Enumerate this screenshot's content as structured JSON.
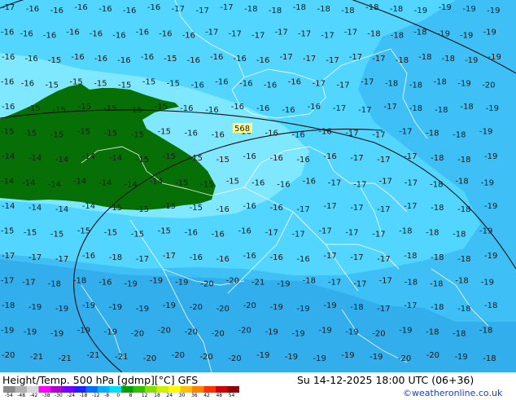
{
  "map": {
    "colors": {
      "band_minus_14_15": "#7fe8ff",
      "band_minus_16_17": "#52d6ff",
      "band_minus_18_19": "#3ec0f6",
      "band_minus_20": "#32aeec",
      "warm_core": "#067006",
      "border_lines": "#ffffff",
      "contour_lines": "#111111",
      "label_text": "#1a1a1a",
      "height_label_bg": "#ffff90"
    },
    "height_contour_label": "568",
    "temperature_rows": [
      [
        "-17",
        "-16",
        "-16",
        "-16",
        "-16",
        "-16",
        "-16",
        "-17",
        "-17",
        "-17",
        "-18",
        "-18",
        "-18",
        "-18",
        "-18",
        "-18",
        "-18",
        "-19",
        "-19",
        "-19",
        "-19"
      ],
      [
        "-16",
        "-16",
        "-16",
        "-16",
        "-16",
        "-16",
        "-16",
        "-16",
        "-16",
        "-17",
        "-17",
        "-17",
        "-17",
        "-17",
        "-17",
        "-17",
        "-18",
        "-18",
        "-18",
        "-19",
        "-19",
        "-19"
      ],
      [
        "-16",
        "-16",
        "-15",
        "-16",
        "-16",
        "-16",
        "-16",
        "-15",
        "-16",
        "-16",
        "-16",
        "-16",
        "-17",
        "-17",
        "-17",
        "-17",
        "-17",
        "-18",
        "-18",
        "-18",
        "-19",
        "-19"
      ],
      [
        "-16",
        "-16",
        "-15",
        "-15",
        "-15",
        "-15",
        "-15",
        "-15",
        "-16",
        "-16",
        "-16",
        "-16",
        "-16",
        "-17",
        "-17",
        "-17",
        "-18",
        "-18",
        "-18",
        "-19",
        "-20"
      ],
      [
        "-16",
        "-15",
        "-15",
        "-15",
        "-15",
        "-15",
        "-15",
        "-16",
        "-16",
        "-16",
        "-16",
        "-16",
        "-16",
        "-17",
        "-17",
        "-17",
        "-18",
        "-18",
        "-18",
        "-19"
      ],
      [
        "-15",
        "-15",
        "-15",
        "-15",
        "-15",
        "-15",
        "-15",
        "-16",
        "-16",
        "-16",
        "-16",
        "-16",
        "-16",
        "-17",
        "-17",
        "-17",
        "-18",
        "-18",
        "-19"
      ],
      [
        "-14",
        "-14",
        "-14",
        "-14",
        "-14",
        "-15",
        "-15",
        "-15",
        "-15",
        "-16",
        "-16",
        "-16",
        "-16",
        "-17",
        "-17",
        "-17",
        "-18",
        "-18",
        "-19"
      ],
      [
        "-14",
        "-14",
        "-14",
        "-14",
        "-14",
        "-14",
        "-14",
        "-15",
        "-15",
        "-15",
        "-16",
        "-16",
        "-16",
        "-17",
        "-17",
        "-17",
        "-17",
        "-18",
        "-18",
        "-19"
      ],
      [
        "-14",
        "-14",
        "-14",
        "-14",
        "-15",
        "-15",
        "-15",
        "-15",
        "-16",
        "-16",
        "-16",
        "-17",
        "-17",
        "-17",
        "-17",
        "-17",
        "-18",
        "-18",
        "-19"
      ],
      [
        "-15",
        "-15",
        "-15",
        "-15",
        "-15",
        "-15",
        "-15",
        "-16",
        "-16",
        "-16",
        "-17",
        "-17",
        "-17",
        "-17",
        "-17",
        "-18",
        "-18",
        "-18",
        "-19"
      ],
      [
        "-17",
        "-17",
        "-17",
        "-16",
        "-18",
        "-17",
        "-17",
        "-16",
        "-16",
        "-16",
        "-16",
        "-16",
        "-17",
        "-17",
        "-17",
        "-18",
        "-18",
        "-18",
        "-19"
      ],
      [
        "-17",
        "-17",
        "-18",
        "-18",
        "-16",
        "-19",
        "-19",
        "-19",
        "-20",
        "-20",
        "-21",
        "-19",
        "-18",
        "-17",
        "-17",
        "-17",
        "-18",
        "-18",
        "-18",
        "-19"
      ],
      [
        "-18",
        "-19",
        "-19",
        "-19",
        "-19",
        "-19",
        "-19",
        "-20",
        "-20",
        "-20",
        "-19",
        "-19",
        "-19",
        "-18",
        "-17",
        "-17",
        "-18",
        "-18",
        "-18"
      ],
      [
        "-19",
        "-19",
        "-19",
        "-19",
        "-19",
        "-20",
        "-20",
        "-20",
        "-20",
        "-20",
        "-19",
        "-19",
        "-19",
        "-19",
        "-20",
        "-19",
        "-18",
        "-18",
        "-18"
      ],
      [
        "-20",
        "-21",
        "-21",
        "-21",
        "-21",
        "-20",
        "-20",
        "-20",
        "-20",
        "-19",
        "-19",
        "-19",
        "-19",
        "-19",
        "-20",
        "-20",
        "-19",
        "-18"
      ]
    ]
  },
  "footer": {
    "title": "Height/Temp. 500 hPa [gdmp][°C] GFS",
    "datetime": "Su 14-12-2025 18:00 UTC (06+36)",
    "credit": "©weatheronline.co.uk",
    "scale_ticks": [
      "-54",
      "-48",
      "-42",
      "-38",
      "-30",
      "-24",
      "-18",
      "-12",
      "-8",
      "0",
      "8",
      "12",
      "18",
      "24",
      "30",
      "36",
      "42",
      "48",
      "54"
    ],
    "scale_colors": [
      "#8a8a8a",
      "#b0b0b0",
      "#d8d8d8",
      "#ff00ff",
      "#b000d0",
      "#7000ff",
      "#2020ff",
      "#0070ff",
      "#00b0ff",
      "#00e0ff",
      "#00a000",
      "#30c000",
      "#80e000",
      "#d0f000",
      "#ffff00",
      "#ffc000",
      "#ff8000",
      "#ff3000",
      "#d00000",
      "#900000"
    ]
  }
}
